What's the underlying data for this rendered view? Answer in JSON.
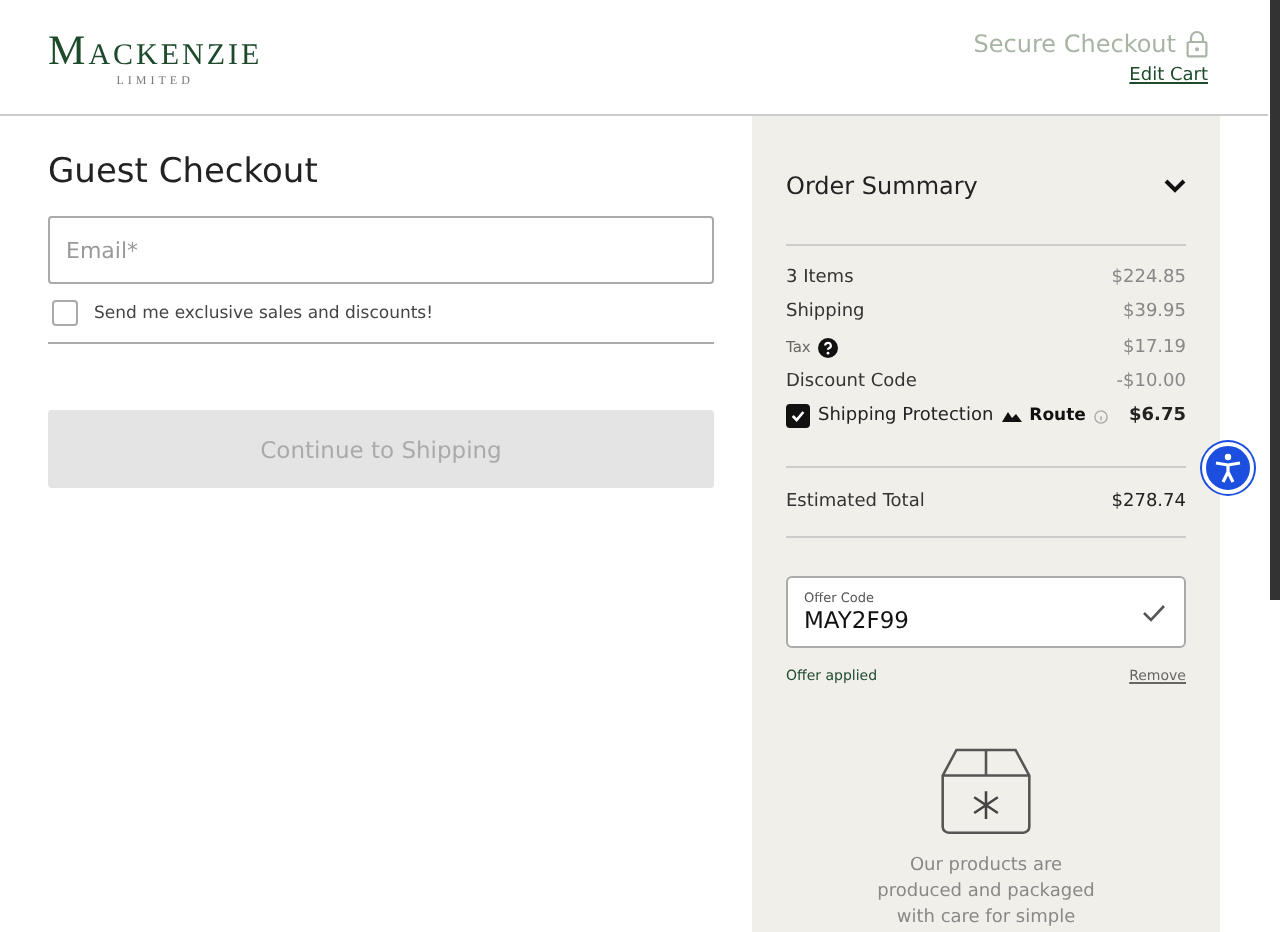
{
  "header": {
    "logo": "MACKENZIE",
    "logo_sub": "LIMITED",
    "secure": "Secure Checkout",
    "edit_cart": "Edit Cart"
  },
  "checkout": {
    "title": "Guest Checkout",
    "email": {
      "placeholder": "Email*"
    },
    "newsletter": {
      "label": "Send me exclusive sales and discounts!",
      "checked": false
    },
    "button": {
      "label": "Continue to Shipping",
      "disabled": true
    }
  },
  "summary": {
    "title": "Order Summary",
    "expanded": true,
    "rows": [
      {
        "kind": "plain",
        "label": "3 Items",
        "value": "$224.85"
      },
      {
        "kind": "plain",
        "label": "Shipping",
        "value": "$39.95"
      },
      {
        "kind": "tax",
        "label": "Tax",
        "value": "$17.19"
      },
      {
        "kind": "plain",
        "label": "Discount Code",
        "value": "-$10.00"
      },
      {
        "kind": "protection",
        "label": "Shipping Protection",
        "brand": "Route",
        "value": "$6.75",
        "checked": true
      }
    ],
    "total": {
      "label": "Estimated Total",
      "value": "$278.74"
    },
    "offer": {
      "label": "Offer Code",
      "value": "MAY2F99",
      "status": "Offer applied",
      "remove": "Remove"
    },
    "note": "Our products are produced and packaged with care for simple"
  }
}
